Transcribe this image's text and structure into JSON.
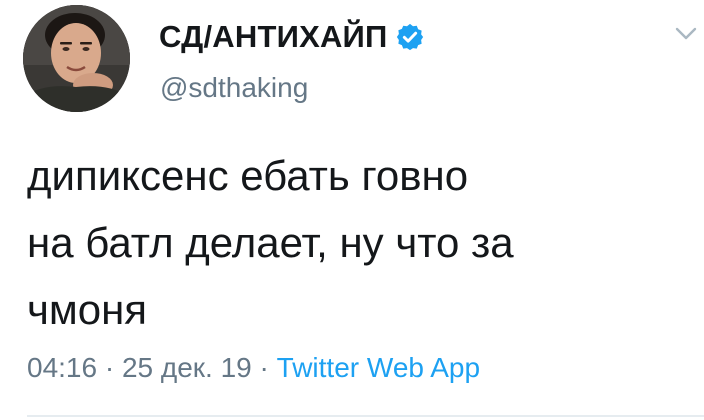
{
  "author": {
    "display_name": "СД/АНТИХАЙП",
    "handle": "@sdthaking",
    "verified": true,
    "avatar_icon": "user-avatar-photo"
  },
  "tweet": {
    "text": "дипиксенс ебать говно\nна батл делает, ну что за\nчмоня"
  },
  "meta": {
    "time": "04:16",
    "separator_1": " · ",
    "date": "25 дек. 19",
    "separator_2": " · ",
    "source": "Twitter Web App"
  },
  "icons": {
    "verified": "verified-badge-icon",
    "menu": "chevron-down-icon"
  },
  "colors": {
    "text": "#14171a",
    "muted": "#657786",
    "accent": "#1da1f2",
    "divider": "#e6ecf0"
  }
}
